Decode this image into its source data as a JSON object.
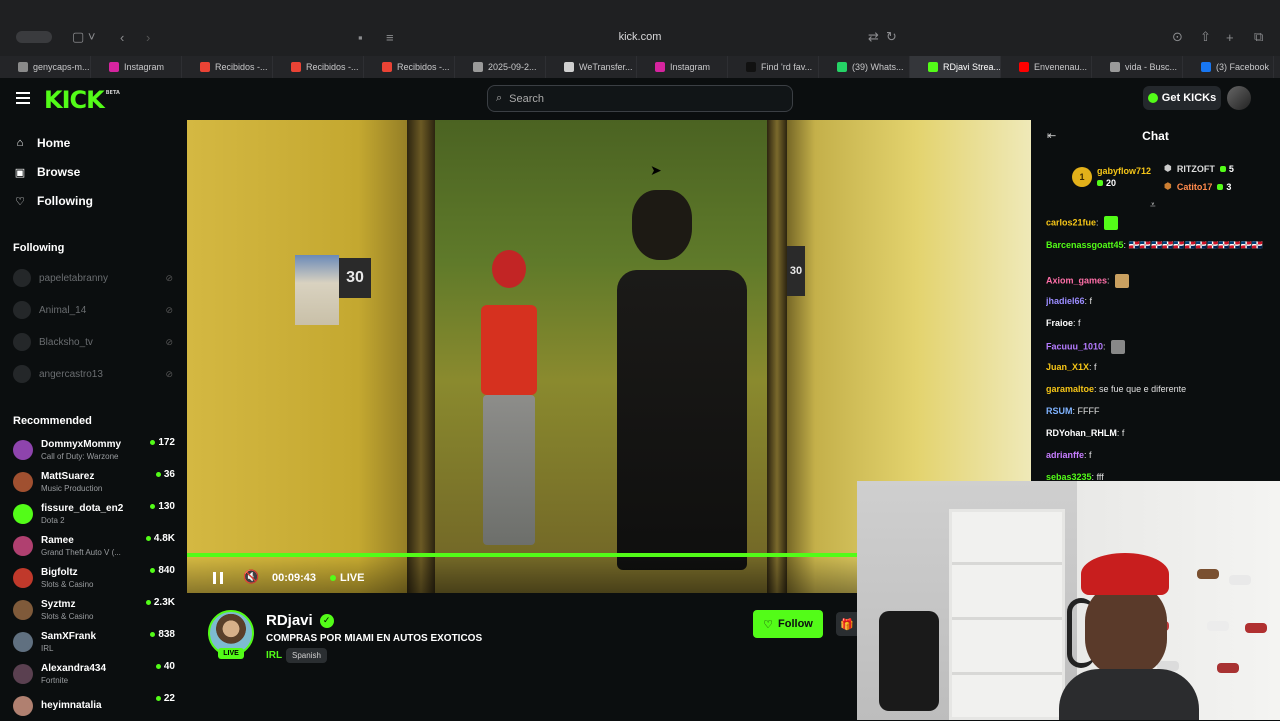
{
  "browser": {
    "url": "kick.com",
    "tabs": [
      {
        "label": "genycaps-m...",
        "color": "#8a8a8a"
      },
      {
        "label": "Instagram",
        "color": "#d6249f"
      },
      {
        "label": "Recibidos -...",
        "color": "#ea4335"
      },
      {
        "label": "Recibidos -...",
        "color": "#ea4335"
      },
      {
        "label": "Recibidos -...",
        "color": "#ea4335"
      },
      {
        "label": "2025-09-2...",
        "color": "#9a9a9a"
      },
      {
        "label": "WeTransfer...",
        "color": "#cfcfcf"
      },
      {
        "label": "Instagram",
        "color": "#d6249f"
      },
      {
        "label": "Find 'rd fav...",
        "color": "#111111"
      },
      {
        "label": "(39) Whats...",
        "color": "#25d366"
      },
      {
        "label": "RDjavi Strea...",
        "color": "#53fc18"
      },
      {
        "label": "Envenenau...",
        "color": "#ff0000"
      },
      {
        "label": "vida - Busc...",
        "color": "#9a9a9a"
      },
      {
        "label": "(3) Facebook",
        "color": "#1877f2"
      }
    ],
    "active_tab": 10
  },
  "header": {
    "logo": "KICK",
    "logo_badge": "BETA",
    "search_placeholder": "Search",
    "get_kicks_label": "Get KICKs"
  },
  "sidebar": {
    "nav": [
      {
        "label": "Home",
        "icon": "home-icon",
        "glyph": "⌂"
      },
      {
        "label": "Browse",
        "icon": "browse-icon",
        "glyph": "▣"
      },
      {
        "label": "Following",
        "icon": "heart-icon",
        "glyph": "♡"
      }
    ],
    "following_title": "Following",
    "following": [
      {
        "name": "papeletabranny"
      },
      {
        "name": "Animal_14"
      },
      {
        "name": "Blacksho_tv"
      },
      {
        "name": "angercastro13"
      }
    ],
    "recommended_title": "Recommended",
    "recommended": [
      {
        "name": "DommyxMommy",
        "game": "Call of Duty: Warzone",
        "viewers": "172",
        "color": "#8e44ad"
      },
      {
        "name": "MattSuarez",
        "game": "Music Production",
        "viewers": "36",
        "color": "#a05030"
      },
      {
        "name": "fissure_dota_en2",
        "game": "Dota 2",
        "viewers": "130",
        "color": "#53fc18"
      },
      {
        "name": "Ramee",
        "game": "Grand Theft Auto V (...",
        "viewers": "4.8K",
        "color": "#b04070"
      },
      {
        "name": "Bigfoltz",
        "game": "Slots & Casino",
        "viewers": "840",
        "color": "#c0392b"
      },
      {
        "name": "Syztmz",
        "game": "Slots & Casino",
        "viewers": "2.3K",
        "color": "#7f5a3a"
      },
      {
        "name": "SamXFrank",
        "game": "IRL",
        "viewers": "838",
        "color": "#607080"
      },
      {
        "name": "Alexandra434",
        "game": "Fortnite",
        "viewers": "40",
        "color": "#5a4050"
      },
      {
        "name": "heyimnatalia",
        "game": "",
        "viewers": "22",
        "color": "#b08070"
      }
    ]
  },
  "player": {
    "progress": 0.8,
    "time": "00:09:43",
    "live_label": "LIVE",
    "room_numbers": [
      "30",
      "30"
    ]
  },
  "stream": {
    "name": "RDjavi",
    "live_badge": "LIVE",
    "title": "COMPRAS POR MIAMI EN AUTOS EXOTICOS",
    "category": "IRL",
    "language": "Spanish",
    "follow_label": "Follow"
  },
  "chat": {
    "title": "Chat",
    "gifters": [
      {
        "rank": "1",
        "name": "gabyflow712",
        "count": "20"
      },
      {
        "name": "RITZOFT",
        "count": "5"
      },
      {
        "name": "Catito17",
        "count": "3"
      }
    ],
    "messages": [
      {
        "user": "carlos21fue",
        "text": "",
        "color": "#f5c518",
        "emote": "#53fc18"
      },
      {
        "user": "Barcenassgoatt45",
        "text": "🇩🇴🇩🇴🇩🇴🇩🇴🇩🇴🇩🇴🇩🇴🇩🇴🇩🇴🇩🇴🇩🇴🇩🇴",
        "color": "#53fc18",
        "emote": ""
      },
      {
        "user": "Axiom_games",
        "text": "",
        "color": "#ff6fa8",
        "emote": "#c9a060"
      },
      {
        "user": "jhadiel66",
        "text": "f",
        "color": "#9b8cff",
        "emote": ""
      },
      {
        "user": "Fraioe",
        "text": "f",
        "color": "#ffffff",
        "emote": ""
      },
      {
        "user": "Facuuu_1010",
        "text": "",
        "color": "#b57bff",
        "emote": "#888888"
      },
      {
        "user": "Juan_X1X",
        "text": "f",
        "color": "#f5c518",
        "emote": ""
      },
      {
        "user": "garamaltoe",
        "text": "se fue que e diferente",
        "color": "#f5c518",
        "emote": ""
      },
      {
        "user": "RSUM",
        "text": "FFFF",
        "color": "#7fb3ff",
        "emote": ""
      },
      {
        "user": "RDYohan_RHLM",
        "text": "f",
        "color": "#ffffff",
        "emote": ""
      },
      {
        "user": "adrianffe",
        "text": "f",
        "color": "#c77dff",
        "emote": ""
      },
      {
        "user": "sebas3235",
        "text": "fff",
        "color": "#53fc18",
        "emote": ""
      }
    ]
  },
  "colors": {
    "accent": "#53fc18",
    "background": "#0b0e0f"
  }
}
